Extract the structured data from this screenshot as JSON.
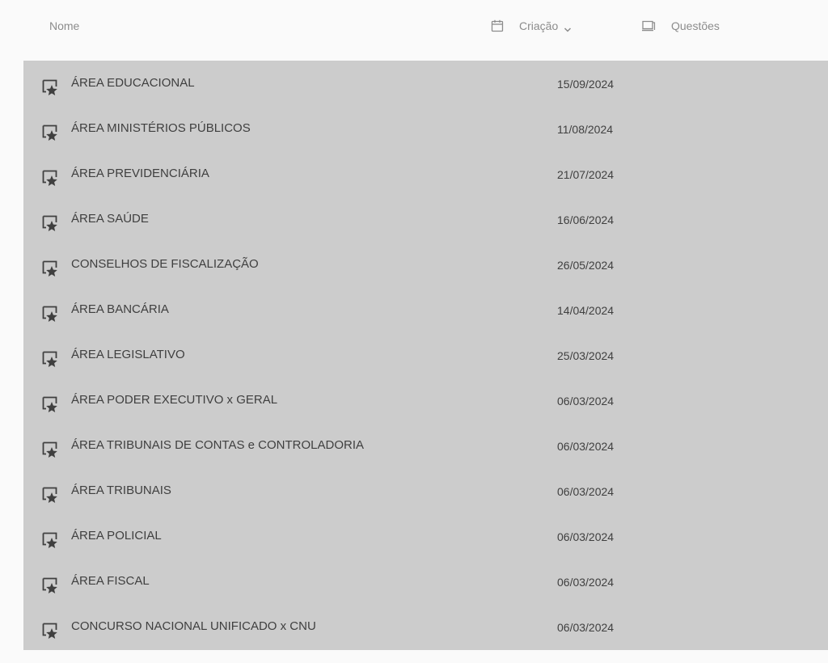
{
  "header": {
    "name_label": "Nome",
    "date_label": "Criação",
    "questions_label": "Questões",
    "date_icon": "calendar-icon",
    "sort_icon": "chevron-down-icon",
    "questions_icon": "questions-icon"
  },
  "colors": {
    "background": "#fafafa",
    "list_background": "#cccccc",
    "text": "#3f3f3f",
    "header_text": "#8c8c8c"
  },
  "rows": [
    {
      "name": "ÁREA EDUCACIONAL",
      "date": "15/09/2024",
      "icon": "bookmark-star-icon"
    },
    {
      "name": "ÁREA MINISTÉRIOS PÚBLICOS",
      "date": "11/08/2024",
      "icon": "bookmark-star-icon"
    },
    {
      "name": "ÁREA PREVIDENCIÁRIA",
      "date": "21/07/2024",
      "icon": "bookmark-star-icon"
    },
    {
      "name": "ÁREA SAÚDE",
      "date": "16/06/2024",
      "icon": "bookmark-star-icon"
    },
    {
      "name": "CONSELHOS DE FISCALIZAÇÃO",
      "date": "26/05/2024",
      "icon": "bookmark-star-icon"
    },
    {
      "name": "ÁREA BANCÁRIA",
      "date": "14/04/2024",
      "icon": "bookmark-star-icon"
    },
    {
      "name": "ÁREA LEGISLATIVO",
      "date": "25/03/2024",
      "icon": "bookmark-star-icon"
    },
    {
      "name": "ÁREA PODER EXECUTIVO x GERAL",
      "date": "06/03/2024",
      "icon": "bookmark-star-icon"
    },
    {
      "name": "ÁREA TRIBUNAIS DE CONTAS e CONTROLADORIA",
      "date": "06/03/2024",
      "icon": "bookmark-star-icon"
    },
    {
      "name": "ÁREA TRIBUNAIS",
      "date": "06/03/2024",
      "icon": "bookmark-star-icon"
    },
    {
      "name": "ÁREA POLICIAL",
      "date": "06/03/2024",
      "icon": "bookmark-star-icon"
    },
    {
      "name": "ÁREA FISCAL",
      "date": "06/03/2024",
      "icon": "bookmark-star-icon"
    },
    {
      "name": "CONCURSO NACIONAL UNIFICADO x CNU",
      "date": "06/03/2024",
      "icon": "bookmark-star-icon"
    }
  ]
}
